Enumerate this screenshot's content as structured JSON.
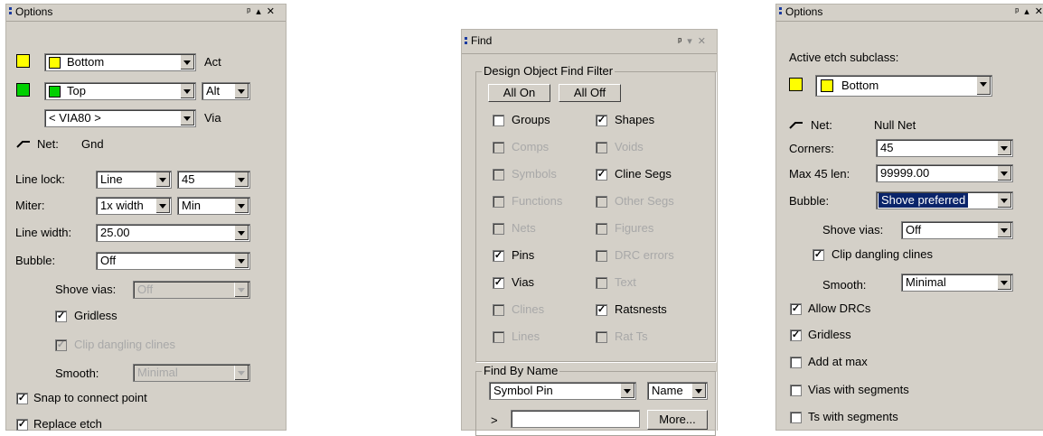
{
  "panel1": {
    "title": "Options",
    "act_value": "Bottom",
    "act_label": "Act",
    "alt_value": "Top",
    "alt_combo": "Alt",
    "via_value": "< VIA80 >",
    "via_label": "Via",
    "net_label": "Net:",
    "net_value": "Gnd",
    "line_lock_label": "Line lock:",
    "line_lock_value": "Line",
    "line_lock_angle": "45",
    "miter_label": "Miter:",
    "miter_value": "1x width",
    "miter_mode": "Min",
    "line_width_label": "Line width:",
    "line_width_value": "25.00",
    "bubble_label": "Bubble:",
    "bubble_value": "Off",
    "shove_vias_label": "Shove vias:",
    "shove_vias_value": "Off",
    "gridless_label": "Gridless",
    "clip_label": "Clip dangling clines",
    "smooth_label": "Smooth:",
    "smooth_value": "Minimal",
    "snap_label": "Snap to connect point",
    "replace_label": "Replace etch"
  },
  "panel2": {
    "title": "Find",
    "filter_title": "Design Object Find Filter",
    "all_on": "All On",
    "all_off": "All Off",
    "items": [
      {
        "label": "Groups",
        "checked": false,
        "enabled": true
      },
      {
        "label": "Shapes",
        "checked": true,
        "enabled": true
      },
      {
        "label": "Comps",
        "checked": false,
        "enabled": false
      },
      {
        "label": "Voids",
        "checked": false,
        "enabled": false
      },
      {
        "label": "Symbols",
        "checked": false,
        "enabled": false
      },
      {
        "label": "Cline Segs",
        "checked": true,
        "enabled": true
      },
      {
        "label": "Functions",
        "checked": false,
        "enabled": false
      },
      {
        "label": "Other Segs",
        "checked": false,
        "enabled": false
      },
      {
        "label": "Nets",
        "checked": false,
        "enabled": false
      },
      {
        "label": "Figures",
        "checked": false,
        "enabled": false
      },
      {
        "label": "Pins",
        "checked": true,
        "enabled": true
      },
      {
        "label": "DRC errors",
        "checked": false,
        "enabled": false
      },
      {
        "label": "Vias",
        "checked": true,
        "enabled": true
      },
      {
        "label": "Text",
        "checked": false,
        "enabled": false
      },
      {
        "label": "Clines",
        "checked": false,
        "enabled": false
      },
      {
        "label": "Ratsnests",
        "checked": true,
        "enabled": true
      },
      {
        "label": "Lines",
        "checked": false,
        "enabled": false
      },
      {
        "label": "Rat Ts",
        "checked": false,
        "enabled": false
      }
    ],
    "find_by_name_title": "Find By Name",
    "symbol_pin_value": "Symbol Pin",
    "name_value": "Name",
    "prompt": ">",
    "name_input": "",
    "more_button": "More..."
  },
  "panel3": {
    "title": "Options",
    "active_etch_label": "Active etch subclass:",
    "active_etch_value": "Bottom",
    "net_label": "Net:",
    "net_value": "Null Net",
    "corners_label": "Corners:",
    "corners_value": "45",
    "max45_label": "Max 45 len:",
    "max45_value": "99999.00",
    "bubble_label": "Bubble:",
    "bubble_value": "Shove preferred",
    "shove_vias_label": "Shove vias:",
    "shove_vias_value": "Off",
    "clip_label": "Clip dangling clines",
    "smooth_label": "Smooth:",
    "smooth_value": "Minimal",
    "allow_drcs": "Allow DRCs",
    "gridless": "Gridless",
    "add_at_max": "Add at max",
    "vias_with_segments": "Vias with segments",
    "ts_with_segments": "Ts with segments"
  },
  "colors": {
    "panel_bg": "#d4d0c8",
    "selection": "#0a246a",
    "swatch_yellow": "#ffff00",
    "swatch_green": "#00d000",
    "grip": "#1a3aa0"
  },
  "icons": [
    "pin-icon",
    "restore-icon",
    "close-icon",
    "chevron-down-icon",
    "net-icon"
  ]
}
